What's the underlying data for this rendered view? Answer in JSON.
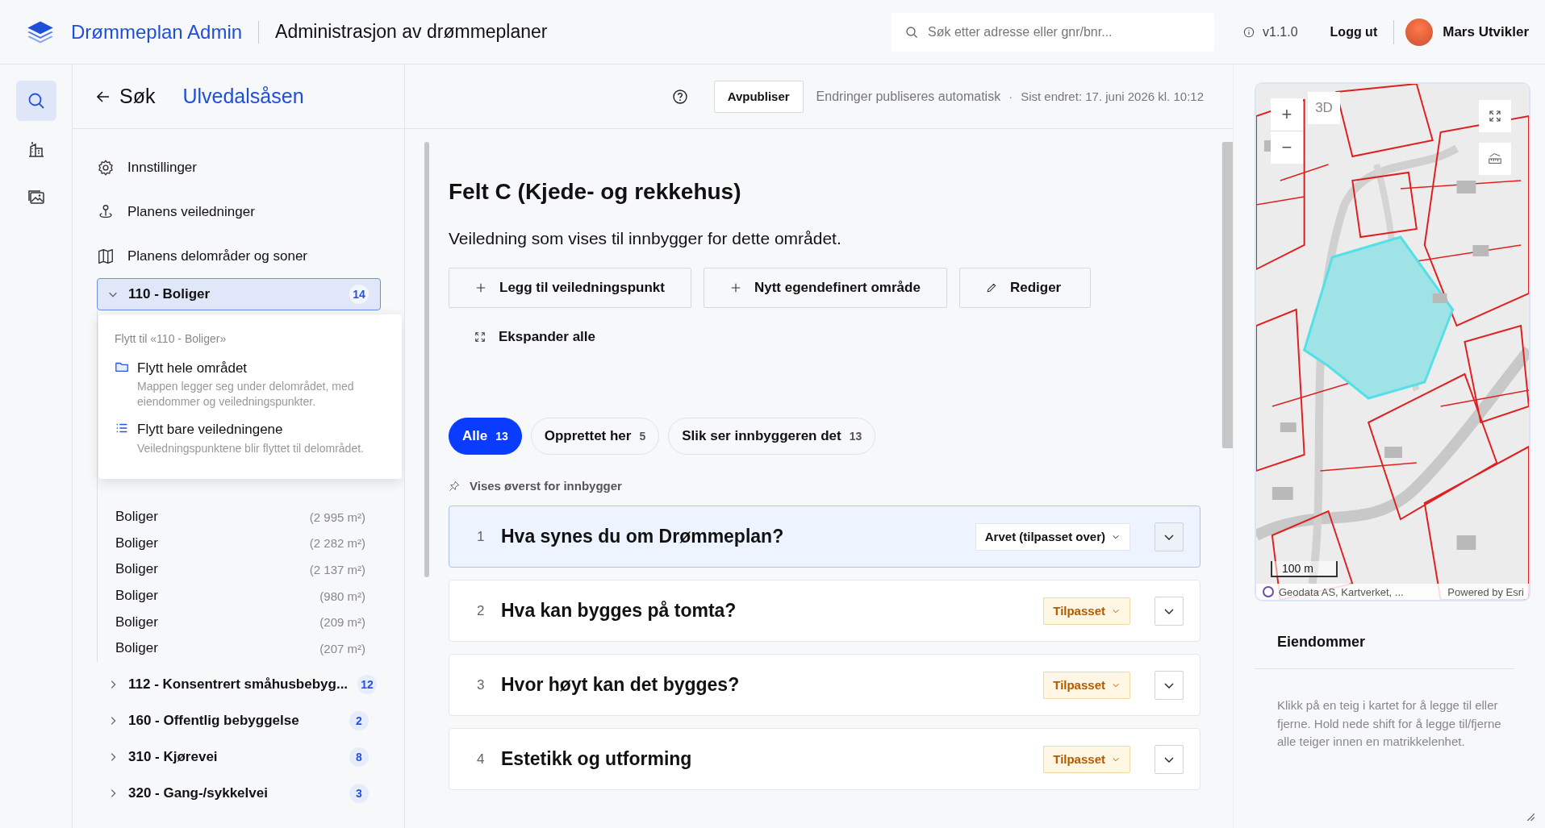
{
  "header": {
    "app_name": "Drømmeplan Admin",
    "subtitle": "Administrasjon av drømmeplaner",
    "search": {
      "placeholder": "Søk etter adresse eller gnr/bnr..."
    },
    "version": "v1.1.0",
    "logout": "Logg ut",
    "user": "Mars Utvikler"
  },
  "rail": [
    {
      "kind": "search",
      "selected": true
    },
    {
      "kind": "buildings",
      "selected": false
    },
    {
      "kind": "gallery",
      "selected": false
    }
  ],
  "sidebar": {
    "back": "Søk",
    "plan": "Ulvedalsåsen",
    "nav": [
      {
        "kind": "settings",
        "label": "Innstillinger"
      },
      {
        "kind": "pin",
        "label": "Planens veiledninger"
      },
      {
        "kind": "map",
        "label": "Planens delområder og soner"
      }
    ],
    "tree": [
      {
        "label": "110 - Boliger",
        "count": "14",
        "expanded": true,
        "selected": true,
        "children": [
          {
            "label": "Boliger",
            "area": "(2 995 m²)"
          },
          {
            "label": "Boliger",
            "area": "(2 282 m²)"
          },
          {
            "label": "Boliger",
            "area": "(2 137 m²)"
          },
          {
            "label": "Boliger",
            "area": "(980 m²)"
          },
          {
            "label": "Boliger",
            "area": "(209 m²)"
          },
          {
            "label": "Boliger",
            "area": "(207 m²)"
          }
        ]
      },
      {
        "label": "112 - Konsentrert småhusbebyg...",
        "count": "12",
        "expanded": false,
        "selected": false
      },
      {
        "label": "160 - Offentlig bebyggelse",
        "count": "2",
        "expanded": false,
        "selected": false
      },
      {
        "label": "310 - Kjørevei",
        "count": "8",
        "expanded": false,
        "selected": false
      },
      {
        "label": "320 - Gang-/sykkelvei",
        "count": "3",
        "expanded": false,
        "selected": false
      }
    ]
  },
  "move_menu": {
    "title": "Flytt til «110 - Boliger»",
    "options": [
      {
        "kind": "folder",
        "label": "Flytt hele området",
        "description": "Mappen legger seg under delområdet, med eiendommer og veiledningspunkter."
      },
      {
        "kind": "list",
        "label": "Flytt bare veiledningene",
        "description": "Veiledningspunktene blir flyttet til delområdet."
      }
    ]
  },
  "toolbar": {
    "unpublish": "Avpubliser",
    "autosave": "Endringer publiseres automatisk",
    "separator": "·",
    "last_changed": "Sist endret: 17. juni 2026 kl. 10:12"
  },
  "content": {
    "title": "Felt C (Kjede- og rekkehus)",
    "description": "Veiledning som vises til innbygger for dette området.",
    "actions": [
      {
        "kind": "add",
        "label": "Legg til veiledningspunkt"
      },
      {
        "kind": "add",
        "label": "Nytt egendefinert område"
      },
      {
        "kind": "edit",
        "label": "Rediger"
      }
    ],
    "expand_all": "Ekspander alle",
    "filters": [
      {
        "label": "Alle",
        "count": "13",
        "selected": true
      },
      {
        "label": "Opprettet her",
        "count": "5",
        "selected": false
      },
      {
        "label": "Slik ser innbyggeren det",
        "count": "13",
        "selected": false
      }
    ],
    "pinned_label": "Vises øverst for innbygger",
    "items": [
      {
        "number": "1",
        "title": "Hva synes du om Drømmeplan?",
        "status": "Arvet (tilpasset over)",
        "kind": "inherited",
        "selected": true
      },
      {
        "number": "2",
        "title": "Hva kan bygges på tomta?",
        "status": "Tilpasset",
        "kind": "custom",
        "selected": false
      },
      {
        "number": "3",
        "title": "Hvor høyt kan det bygges?",
        "status": "Tilpasset",
        "kind": "custom",
        "selected": false
      },
      {
        "number": "4",
        "title": "Estetikk og utforming",
        "status": "Tilpasset",
        "kind": "custom",
        "selected": false
      }
    ]
  },
  "map": {
    "zoom_in": "+",
    "zoom_out": "−",
    "mode": "3D",
    "scale": "100 m",
    "attribution": "Geodata AS, Kartverket, ...",
    "powered_by": "Powered by Esri"
  },
  "properties": {
    "title": "Eiendommer",
    "hint": "Klikk på en teig i kartet for å legge til eller fjerne. Hold nede shift for å legge til/fjerne alle teiger innen en matrikkelenhet."
  }
}
